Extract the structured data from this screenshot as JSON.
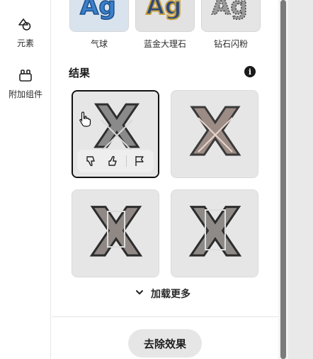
{
  "rail": {
    "items": [
      {
        "label": "元素",
        "icon": "shapes-icon"
      },
      {
        "label": "附加组件",
        "icon": "addons-icon"
      }
    ]
  },
  "styles": {
    "items": [
      {
        "label": "气球",
        "thumb_text": "Ag"
      },
      {
        "label": "蓝金大理石",
        "thumb_text": "Ag"
      },
      {
        "label": "钻石闪粉",
        "thumb_text": "Ag"
      }
    ]
  },
  "results": {
    "title": "结果",
    "info_glyph": "i",
    "tiles": [
      {
        "glyph": "X",
        "selected": true
      },
      {
        "glyph": "X",
        "selected": false
      },
      {
        "glyph": "X",
        "selected": false
      },
      {
        "glyph": "X",
        "selected": false
      }
    ]
  },
  "load_more": {
    "label": "加载更多"
  },
  "remove_button": {
    "label": "去除效果"
  },
  "colors": {
    "accent_dark": "#111111",
    "button_bg": "#e6e6e6",
    "tile_bg": "#e9e9e9",
    "scroll_thumb": "#7b7b7b"
  }
}
